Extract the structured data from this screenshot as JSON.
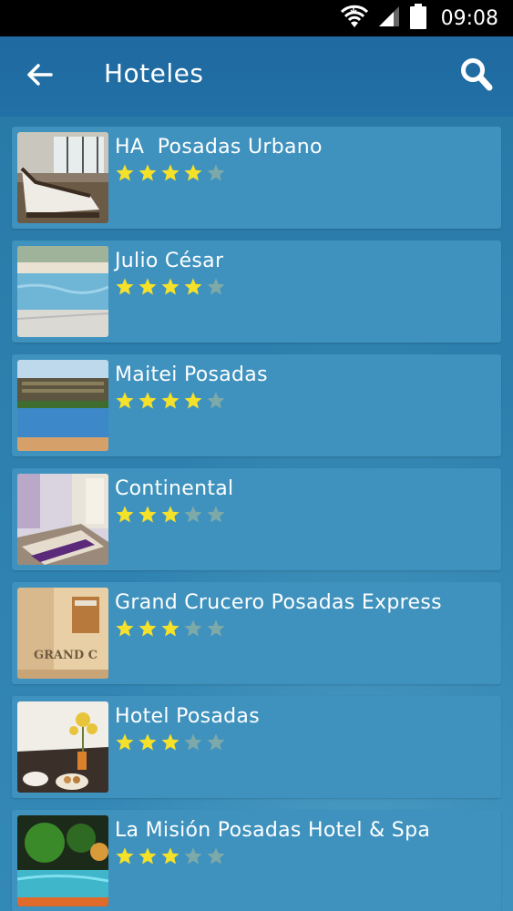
{
  "status_bar": {
    "time": "09:08"
  },
  "app_bar": {
    "title": "Hoteles"
  },
  "hotels": [
    {
      "name": "HA  Posadas Urbano",
      "rating": 4,
      "max_rating": 5,
      "image": "spa-lounge-photo"
    },
    {
      "name": "Julio César",
      "rating": 4,
      "max_rating": 5,
      "image": "pool-photo"
    },
    {
      "name": "Maitei Posadas",
      "rating": 4,
      "max_rating": 5,
      "image": "resort-pool-photo"
    },
    {
      "name": "Continental",
      "rating": 3,
      "max_rating": 5,
      "image": "bedroom-photo"
    },
    {
      "name": "Grand Crucero Posadas Express",
      "rating": 3,
      "max_rating": 5,
      "image": "lobby-sign-photo"
    },
    {
      "name": "Hotel Posadas",
      "rating": 3,
      "max_rating": 5,
      "image": "breakfast-tray-photo"
    },
    {
      "name": "La Misión Posadas Hotel & Spa",
      "rating": 3,
      "max_rating": 5,
      "image": "night-pool-photo"
    }
  ],
  "colors": {
    "app_bar": "#1f6aa0",
    "card": "#3f92be",
    "star_filled": "#f5e12a",
    "star_empty": "#7ea9a9"
  }
}
